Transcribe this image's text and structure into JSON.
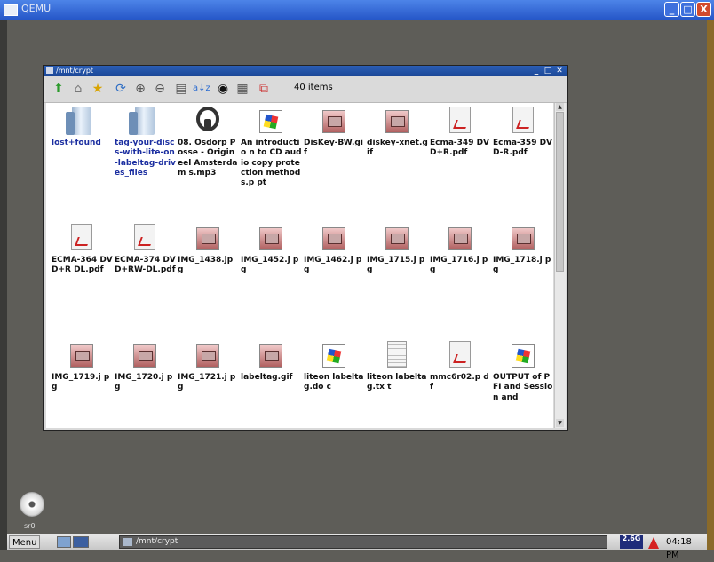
{
  "qemu": {
    "title": "QEMU",
    "min": "_",
    "max": "□",
    "close": "X"
  },
  "window": {
    "title": "/mnt/crypt",
    "min": "_",
    "max": "□",
    "close": "✕",
    "item_count": "40 items",
    "toolbar_icons": [
      "up-icon",
      "home-icon",
      "bookmark-icon",
      "refresh-icon",
      "zoom-in-icon",
      "zoom-out-icon",
      "view-icon",
      "sort-icon",
      "show-hidden-icon",
      "details-icon",
      "new-window-icon"
    ]
  },
  "files": [
    {
      "name": "lost+found",
      "type": "folder",
      "dir": true
    },
    {
      "name": "tag-your-discs-with-lite-on-labeltag-drives_files",
      "type": "folder",
      "dir": true
    },
    {
      "name": "08. Osdorp Posse - Origineel Amsterdam s.mp3",
      "type": "audio"
    },
    {
      "name": "An introductio n to CD audio copy protection methods.p pt",
      "type": "doc"
    },
    {
      "name": "DisKey-BW.gif",
      "type": "img"
    },
    {
      "name": "diskey-xnet.gif",
      "type": "img"
    },
    {
      "name": "Ecma-349 DVD+R.pdf",
      "type": "pdf"
    },
    {
      "name": "Ecma-359 DVD-R.pdf",
      "type": "pdf"
    },
    {
      "name": "ECMA-364 DVD+R DL.pdf",
      "type": "pdf"
    },
    {
      "name": "ECMA-374 DVD+RW-DL.pdf",
      "type": "pdf"
    },
    {
      "name": "IMG_1438.jp g",
      "type": "img"
    },
    {
      "name": "IMG_1452.j pg",
      "type": "img"
    },
    {
      "name": "IMG_1462.j pg",
      "type": "img"
    },
    {
      "name": "IMG_1715.j pg",
      "type": "img"
    },
    {
      "name": "IMG_1716.j pg",
      "type": "img"
    },
    {
      "name": "IMG_1718.j pg",
      "type": "img"
    },
    {
      "name": "IMG_1719.j pg",
      "type": "img"
    },
    {
      "name": "IMG_1720.j pg",
      "type": "img"
    },
    {
      "name": "IMG_1721.j pg",
      "type": "img"
    },
    {
      "name": "labeltag.gif",
      "type": "img"
    },
    {
      "name": "liteon labeltag.do c",
      "type": "doc"
    },
    {
      "name": "liteon labeltag.tx t",
      "type": "txt"
    },
    {
      "name": "mmc6r02.p df",
      "type": "pdf"
    },
    {
      "name": "OUTPUT of PFI and Session and",
      "type": "doc"
    }
  ],
  "desktop_icon": {
    "label": "sr0"
  },
  "taskbar": {
    "menu": "Menu",
    "task_title": "/mnt/crypt",
    "tray_text": "2.6G",
    "clock": "04:18 PM"
  }
}
